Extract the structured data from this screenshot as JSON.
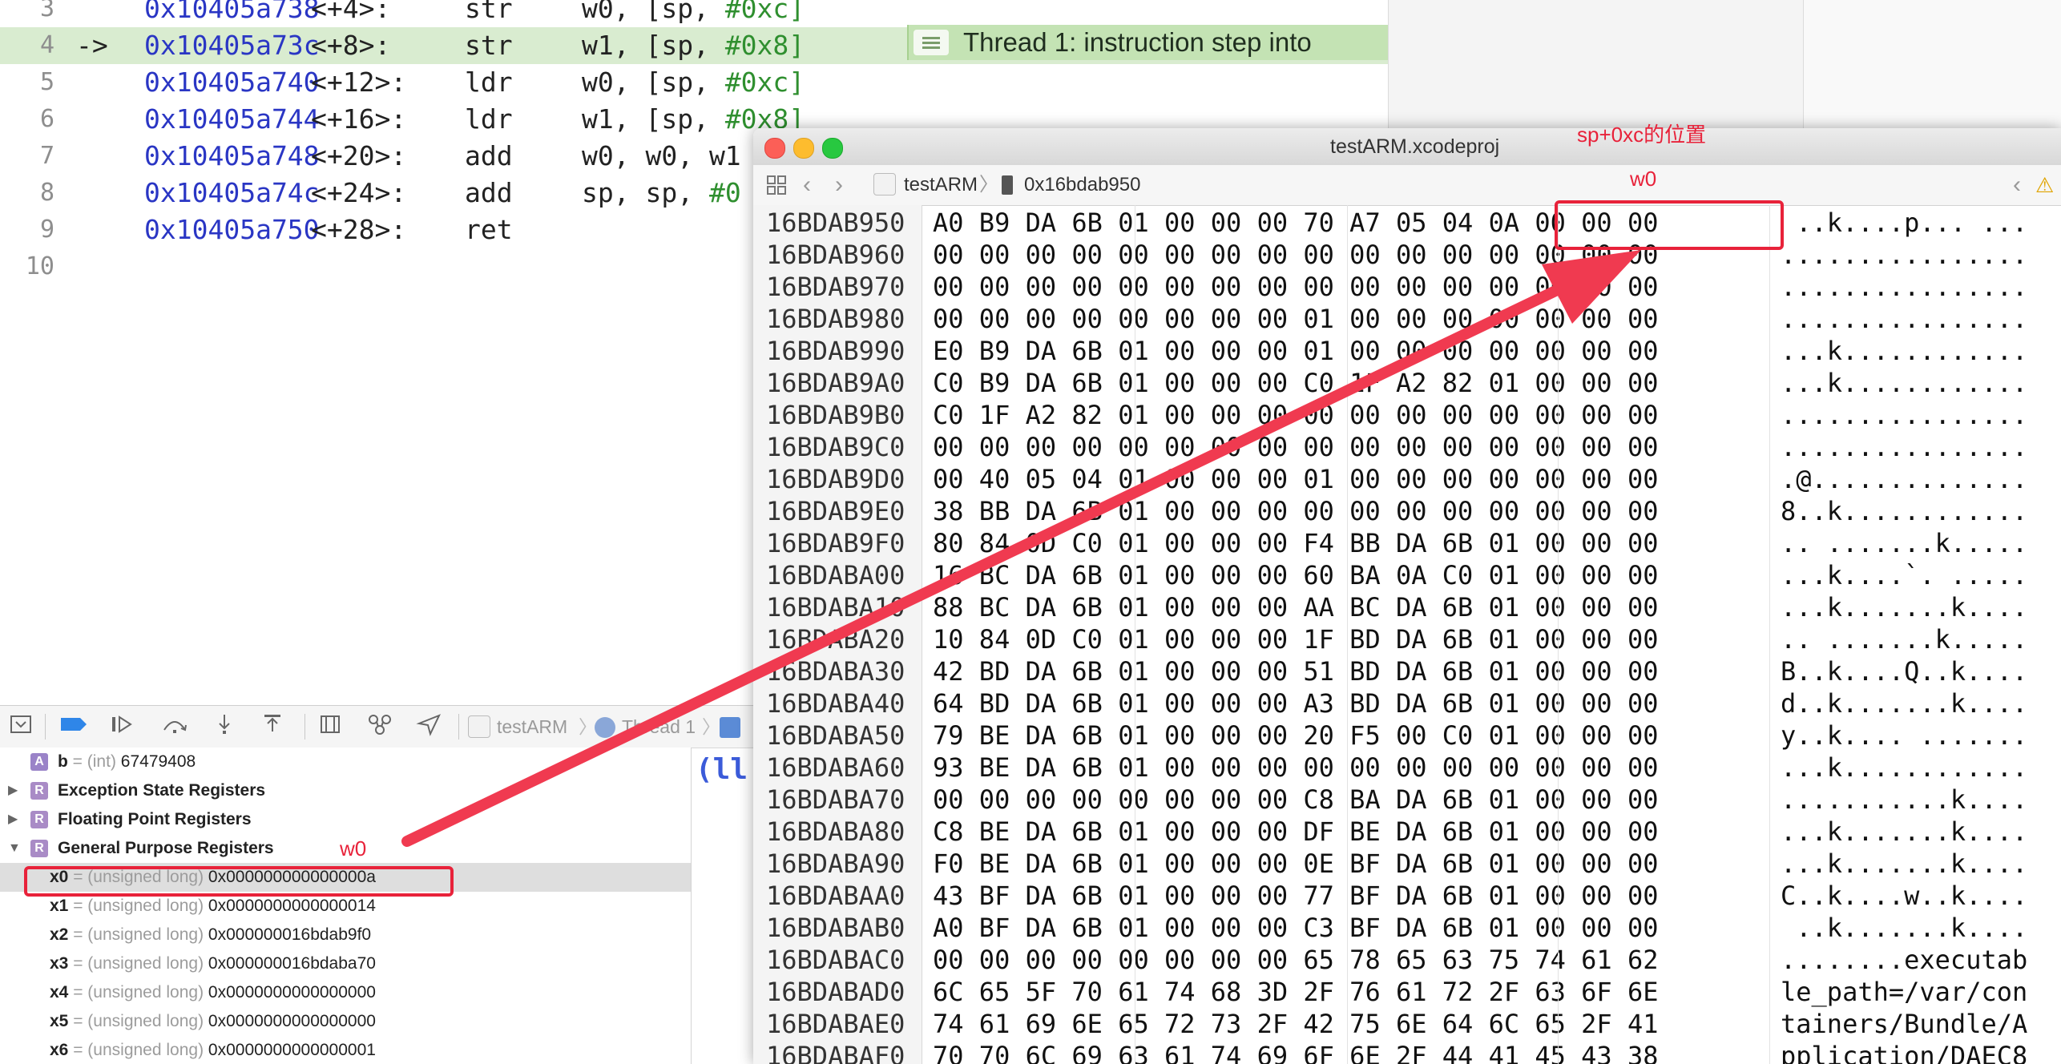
{
  "disassembly": {
    "lines": [
      {
        "num": "3",
        "arrow": "",
        "addr": "0x10405a738",
        "offset": "<+4>:",
        "mnemonic": "str",
        "ops": "w0, [sp, ",
        "imm": "#0xc]",
        "tail": ""
      },
      {
        "num": "4",
        "arrow": "->",
        "addr": "0x10405a73c",
        "offset": "<+8>:",
        "mnemonic": "str",
        "ops": "w1, [sp, ",
        "imm": "#0x8]",
        "tail": ""
      },
      {
        "num": "5",
        "arrow": "",
        "addr": "0x10405a740",
        "offset": "<+12>:",
        "mnemonic": "ldr",
        "ops": "w0, [sp, ",
        "imm": "#0xc]",
        "tail": ""
      },
      {
        "num": "6",
        "arrow": "",
        "addr": "0x10405a744",
        "offset": "<+16>:",
        "mnemonic": "ldr",
        "ops": "w1, [sp, ",
        "imm": "#0x8]",
        "tail": ""
      },
      {
        "num": "7",
        "arrow": "",
        "addr": "0x10405a748",
        "offset": "<+20>:",
        "mnemonic": "add",
        "ops": "w0, w0, w1",
        "imm": "",
        "tail": ""
      },
      {
        "num": "8",
        "arrow": "",
        "addr": "0x10405a74c",
        "offset": "<+24>:",
        "mnemonic": "add",
        "ops": "sp, sp, ",
        "imm": "#0",
        "tail": ""
      },
      {
        "num": "9",
        "arrow": "",
        "addr": "0x10405a750",
        "offset": "<+28>:",
        "mnemonic": "ret",
        "ops": "",
        "imm": "",
        "tail": ""
      },
      {
        "num": "10",
        "arrow": "",
        "addr": "",
        "offset": "",
        "mnemonic": "",
        "ops": "",
        "imm": "",
        "tail": ""
      }
    ],
    "current_line_index": 1,
    "thread_badge": "Thread 1: instruction step into"
  },
  "debug_bar": {
    "icons": [
      "hide-debug-area-icon",
      "breakpoints-toggle-icon",
      "continue-icon",
      "step-over-icon",
      "step-into-icon",
      "step-out-icon",
      "view-hierarchy-icon",
      "memory-graph-icon",
      "simulate-location-icon"
    ],
    "breadcrumb": [
      "testARM",
      "Thread 1"
    ]
  },
  "variables": {
    "rows": [
      {
        "kind": "var",
        "badge": "A",
        "name": "b",
        "type": "(int)",
        "value": "67479408",
        "expandable": false
      },
      {
        "kind": "group",
        "badge": "R",
        "name": "Exception State Registers",
        "expandable": true,
        "expanded": false
      },
      {
        "kind": "group",
        "badge": "R",
        "name": "Floating Point Registers",
        "expandable": true,
        "expanded": false
      },
      {
        "kind": "group",
        "badge": "R",
        "name": "General Purpose Registers",
        "expandable": true,
        "expanded": true
      },
      {
        "kind": "reg",
        "name": "x0",
        "type": "(unsigned long)",
        "value": "0x000000000000000a",
        "selected": true
      },
      {
        "kind": "reg",
        "name": "x1",
        "type": "(unsigned long)",
        "value": "0x0000000000000014"
      },
      {
        "kind": "reg",
        "name": "x2",
        "type": "(unsigned long)",
        "value": "0x000000016bdab9f0"
      },
      {
        "kind": "reg",
        "name": "x3",
        "type": "(unsigned long)",
        "value": "0x000000016bdaba70"
      },
      {
        "kind": "reg",
        "name": "x4",
        "type": "(unsigned long)",
        "value": "0x0000000000000000"
      },
      {
        "kind": "reg",
        "name": "x5",
        "type": "(unsigned long)",
        "value": "0x0000000000000000"
      },
      {
        "kind": "reg",
        "name": "x6",
        "type": "(unsigned long)",
        "value": "0x0000000000000001"
      }
    ],
    "console_fragment": "(ll"
  },
  "memory_window": {
    "title": "testARM.xcodeproj",
    "path": {
      "project": "testARM",
      "address": "0x16bdab950"
    },
    "rows": [
      {
        "addr": "16BDAB950",
        "hex": "A0 B9 DA 6B 01 00 00 00 70 A7 05 04 0A 00 00 00",
        "ascii": " ..k....p... ..."
      },
      {
        "addr": "16BDAB960",
        "hex": "00 00 00 00 00 00 00 00 00 00 00 00 00 00 00 00",
        "ascii": "................"
      },
      {
        "addr": "16BDAB970",
        "hex": "00 00 00 00 00 00 00 00 00 00 00 00 00 00 00 00",
        "ascii": "................"
      },
      {
        "addr": "16BDAB980",
        "hex": "00 00 00 00 00 00 00 00 01 00 00 00 00 00 00 00",
        "ascii": "................"
      },
      {
        "addr": "16BDAB990",
        "hex": "E0 B9 DA 6B 01 00 00 00 01 00 00 00 00 00 00 00",
        "ascii": "...k............"
      },
      {
        "addr": "16BDAB9A0",
        "hex": "C0 B9 DA 6B 01 00 00 00 C0 1F A2 82 01 00 00 00",
        "ascii": "...k............"
      },
      {
        "addr": "16BDAB9B0",
        "hex": "C0 1F A2 82 01 00 00 00 00 00 00 00 00 00 00 00",
        "ascii": "................"
      },
      {
        "addr": "16BDAB9C0",
        "hex": "00 00 00 00 00 00 00 00 00 00 00 00 00 00 00 00",
        "ascii": "................"
      },
      {
        "addr": "16BDAB9D0",
        "hex": "00 40 05 04 01 00 00 00 01 00 00 00 00 00 00 00",
        "ascii": ".@.............."
      },
      {
        "addr": "16BDAB9E0",
        "hex": "38 BB DA 6B 01 00 00 00 00 00 00 00 00 00 00 00",
        "ascii": "8..k............"
      },
      {
        "addr": "16BDAB9F0",
        "hex": "80 84 0D C0 01 00 00 00 F4 BB DA 6B 01 00 00 00",
        "ascii": ".. .......k....."
      },
      {
        "addr": "16BDABA00",
        "hex": "16 BC DA 6B 01 00 00 00 60 BA 0A C0 01 00 00 00",
        "ascii": "...k....`. ....."
      },
      {
        "addr": "16BDABA10",
        "hex": "88 BC DA 6B 01 00 00 00 AA BC DA 6B 01 00 00 00",
        "ascii": "...k.......k...."
      },
      {
        "addr": "16BDABA20",
        "hex": "10 84 0D C0 01 00 00 00 1F BD DA 6B 01 00 00 00",
        "ascii": ".. .......k....."
      },
      {
        "addr": "16BDABA30",
        "hex": "42 BD DA 6B 01 00 00 00 51 BD DA 6B 01 00 00 00",
        "ascii": "B..k....Q..k...."
      },
      {
        "addr": "16BDABA40",
        "hex": "64 BD DA 6B 01 00 00 00 A3 BD DA 6B 01 00 00 00",
        "ascii": "d..k.......k...."
      },
      {
        "addr": "16BDABA50",
        "hex": "79 BE DA 6B 01 00 00 00 20 F5 00 C0 01 00 00 00",
        "ascii": "y..k.... ......."
      },
      {
        "addr": "16BDABA60",
        "hex": "93 BE DA 6B 01 00 00 00 00 00 00 00 00 00 00 00",
        "ascii": "...k............"
      },
      {
        "addr": "16BDABA70",
        "hex": "00 00 00 00 00 00 00 00 C8 BA DA 6B 01 00 00 00",
        "ascii": "...........k...."
      },
      {
        "addr": "16BDABA80",
        "hex": "C8 BE DA 6B 01 00 00 00 DF BE DA 6B 01 00 00 00",
        "ascii": "...k.......k...."
      },
      {
        "addr": "16BDABA90",
        "hex": "F0 BE DA 6B 01 00 00 00 0E BF DA 6B 01 00 00 00",
        "ascii": "...k.......k...."
      },
      {
        "addr": "16BDABAA0",
        "hex": "43 BF DA 6B 01 00 00 00 77 BF DA 6B 01 00 00 00",
        "ascii": "C..k....w..k...."
      },
      {
        "addr": "16BDABAB0",
        "hex": "A0 BF DA 6B 01 00 00 00 C3 BF DA 6B 01 00 00 00",
        "ascii": " ..k.......k...."
      },
      {
        "addr": "16BDABAC0",
        "hex": "00 00 00 00 00 00 00 00 65 78 65 63 75 74 61 62",
        "ascii": "........executab"
      },
      {
        "addr": "16BDABAD0",
        "hex": "6C 65 5F 70 61 74 68 3D 2F 76 61 72 2F 63 6F 6E",
        "ascii": "le_path=/var/con"
      },
      {
        "addr": "16BDABAE0",
        "hex": "74 61 69 6E 65 72 73 2F 42 75 6E 64 6C 65 2F 41",
        "ascii": "tainers/Bundle/A"
      },
      {
        "addr": "16BDABAF0",
        "hex": "70 70 6C 69 63 61 74 69 6F 6E 2F 44 41 45 43 38",
        "ascii": "pplication/DAEC8"
      }
    ]
  },
  "annotations": {
    "sp_label": "sp+0xc的位置",
    "mem_w0_label": "w0",
    "reg_w0_label": "w0",
    "color": "#e8223a"
  }
}
